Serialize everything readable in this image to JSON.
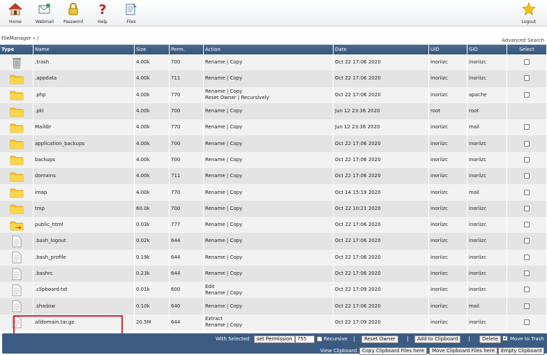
{
  "toolbar": {
    "items": [
      {
        "label": "Home",
        "icon": "home-icon"
      },
      {
        "label": "Webmail",
        "icon": "webmail-icon"
      },
      {
        "label": "Password",
        "icon": "lock-icon"
      },
      {
        "label": "Help",
        "icon": "help-icon"
      },
      {
        "label": "Files",
        "icon": "files-icon"
      }
    ],
    "logout": {
      "label": "Logout",
      "icon": "star-icon"
    }
  },
  "breadcrumb": "FileManager » /",
  "advanced_search": "Advanced Search",
  "table": {
    "headers": [
      "Type",
      "Name",
      "Size",
      "Perm.",
      "Action",
      "Date",
      "UID",
      "GID",
      "Select"
    ],
    "rows": [
      {
        "type": "trash",
        "name": ".trash",
        "size": "4.00k",
        "perm": "700",
        "action1": "Rename | Copy",
        "action2": "",
        "date": "Oct 22 17:06 2020",
        "uid": "inoriizc",
        "gid": "inoriizc",
        "select": true
      },
      {
        "type": "folder",
        "name": ".appdata",
        "size": "4.00k",
        "perm": "711",
        "action1": "Rename | Copy",
        "action2": "",
        "date": "Oct 22 17:06 2020",
        "uid": "inoriizc",
        "gid": "inoriizc",
        "select": true
      },
      {
        "type": "folder",
        "name": ".php",
        "size": "4.00k",
        "perm": "770",
        "action1": "Rename | Copy",
        "action2": "Reset Owner | Recursively",
        "date": "Oct 22 17:06 2020",
        "uid": "inoriizc",
        "gid": "apache",
        "select": true
      },
      {
        "type": "folder",
        "name": ".pki",
        "size": "4.00k",
        "perm": "700",
        "action1": "Rename | Copy",
        "action2": "",
        "date": "Jun 12 23:36 2020",
        "uid": "root",
        "gid": "root",
        "select": false
      },
      {
        "type": "folder",
        "name": "Maildir",
        "size": "4.00k",
        "perm": "770",
        "action1": "Rename | Copy",
        "action2": "",
        "date": "Jun 12 23:36 2020",
        "uid": "inoriizc",
        "gid": "mail",
        "select": true
      },
      {
        "type": "folder",
        "name": "application_backups",
        "size": "4.00k",
        "perm": "700",
        "action1": "Rename | Copy",
        "action2": "",
        "date": "Oct 22 17:06 2020",
        "uid": "inoriizc",
        "gid": "inoriizc",
        "select": true
      },
      {
        "type": "folder",
        "name": "backups",
        "size": "4.00k",
        "perm": "700",
        "action1": "Rename | Copy",
        "action2": "",
        "date": "Oct 22 17:06 2020",
        "uid": "inoriizc",
        "gid": "inoriizc",
        "select": true
      },
      {
        "type": "folder",
        "name": "domains",
        "size": "4.00k",
        "perm": "711",
        "action1": "Rename | Copy",
        "action2": "",
        "date": "Oct 22 17:06 2020",
        "uid": "inoriizc",
        "gid": "inoriizc",
        "select": true
      },
      {
        "type": "folder",
        "name": "imap",
        "size": "4.00k",
        "perm": "770",
        "action1": "Rename | Copy",
        "action2": "",
        "date": "Oct 14 15:19 2020",
        "uid": "inoriizc",
        "gid": "mail",
        "select": true
      },
      {
        "type": "folder",
        "name": "tmp",
        "size": "60.0k",
        "perm": "700",
        "action1": "Rename | Copy",
        "action2": "",
        "date": "Oct 22 10:21 2020",
        "uid": "inoriizc",
        "gid": "inoriizc",
        "select": true
      },
      {
        "type": "folder-link",
        "name": "public_html",
        "size": "0.03k",
        "perm": "777",
        "action1": "Rename | Copy",
        "action2": "",
        "date": "Oct 22 17:06 2020",
        "uid": "inoriizc",
        "gid": "inoriizc",
        "select": true
      },
      {
        "type": "file",
        "name": ".bash_logout",
        "size": "0.02k",
        "perm": "644",
        "action1": "Rename | Copy",
        "action2": "",
        "date": "Oct 22 17:06 2020",
        "uid": "inoriizc",
        "gid": "inoriizc",
        "select": true
      },
      {
        "type": "file",
        "name": ".bash_profile",
        "size": "0.19k",
        "perm": "644",
        "action1": "Rename | Copy",
        "action2": "",
        "date": "Oct 22 17:06 2020",
        "uid": "inoriizc",
        "gid": "inoriizc",
        "select": true
      },
      {
        "type": "file",
        "name": ".bashrc",
        "size": "0.23k",
        "perm": "644",
        "action1": "Rename | Copy",
        "action2": "",
        "date": "Oct 22 17:06 2020",
        "uid": "inoriizc",
        "gid": "inoriizc",
        "select": true
      },
      {
        "type": "file",
        "name": ".clipboard.txt",
        "size": "0.01k",
        "perm": "600",
        "action1": "Edit",
        "action2": "Rename | Copy",
        "date": "Oct 22 17:09 2020",
        "uid": "inoriizc",
        "gid": "inoriizc",
        "select": true
      },
      {
        "type": "file",
        "name": ".shadow",
        "size": "0.10k",
        "perm": "640",
        "action1": "Rename | Copy",
        "action2": "",
        "date": "Oct 22 17:06 2020",
        "uid": "inoriizc",
        "gid": "mail",
        "select": true
      },
      {
        "type": "file",
        "name": "alldomain.tar.gz",
        "size": "20.5M",
        "perm": "644",
        "action1": "Extract",
        "action2": "Rename | Copy",
        "date": "Oct 22 17:09 2020",
        "uid": "inoriizc",
        "gid": "inoriizc",
        "select": true
      }
    ]
  },
  "bottom_bar": {
    "with_selected": "With Selected",
    "set_permission": "set Permission",
    "permission_value": "755",
    "recursive": "Recursive",
    "sep": "|",
    "reset_owner": "Reset Owner",
    "add_to_clipboard": "Add to Clipboard",
    "delete": "Delete",
    "move_to_trash": "Move to Trash",
    "view_clipboard": "View Clipboard",
    "copy_clipboard": "Copy Clipboard Files here",
    "move_clipboard": "Move Clipboard Files here",
    "empty_clipboard": "Empty Clipboard"
  },
  "colors": {
    "header_bg": "#3b5b82",
    "row_odd": "#f2f2f2",
    "row_even": "#e4e4e4",
    "highlight": "#e0202a",
    "folder": "#f5c623"
  }
}
